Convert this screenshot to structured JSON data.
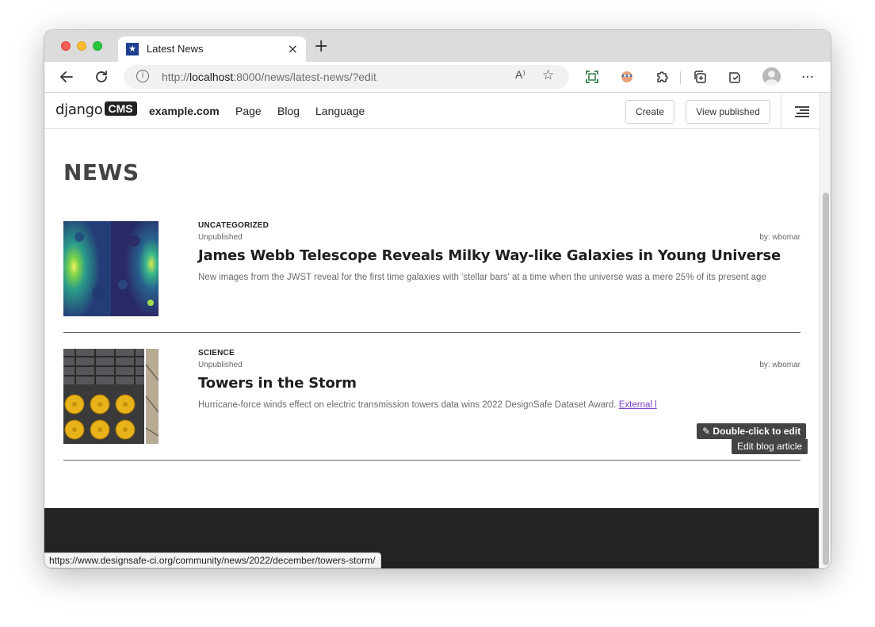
{
  "browser": {
    "tab_title": "Latest News",
    "tab_close": "×",
    "new_tab": "+",
    "url_scheme": "http://",
    "url_host": "localhost",
    "url_rest": ":8000/news/latest-news/?edit",
    "read_aloud_label": "A⁾",
    "status_url": "https://www.designsafe-ci.org/community/news/2022/december/towers-storm/"
  },
  "cms_toolbar": {
    "logo_text": "django",
    "logo_badge": "CMS",
    "site": "example.com",
    "menu": [
      "Page",
      "Blog",
      "Language"
    ],
    "create_label": "Create",
    "view_published_label": "View published"
  },
  "page": {
    "title": "NEWS"
  },
  "articles": [
    {
      "category": "UNCATEGORIZED",
      "status": "Unpublished",
      "author": "by: wbomar",
      "title": "James Webb Telescope Reveals Milky Way-like Galaxies in Young Universe",
      "lead": "New images from the JWST reveal for the first time galaxies with 'stellar bars' at a time when the universe was a mere 25% of its present age"
    },
    {
      "category": "SCIENCE",
      "status": "Unpublished",
      "author": "by: wbomar",
      "title": "Towers in the Storm",
      "lead": "Hurricane-force winds effect on electric transmission towers data wins 2022 DesignSafe Dataset Award.",
      "link_text": "External l"
    }
  ],
  "tooltip": {
    "primary": "Double-click to edit",
    "secondary": "Edit blog article"
  },
  "colors": {
    "footer": "#232323",
    "link": "#7b3fc8",
    "tooltip": "#444444"
  }
}
